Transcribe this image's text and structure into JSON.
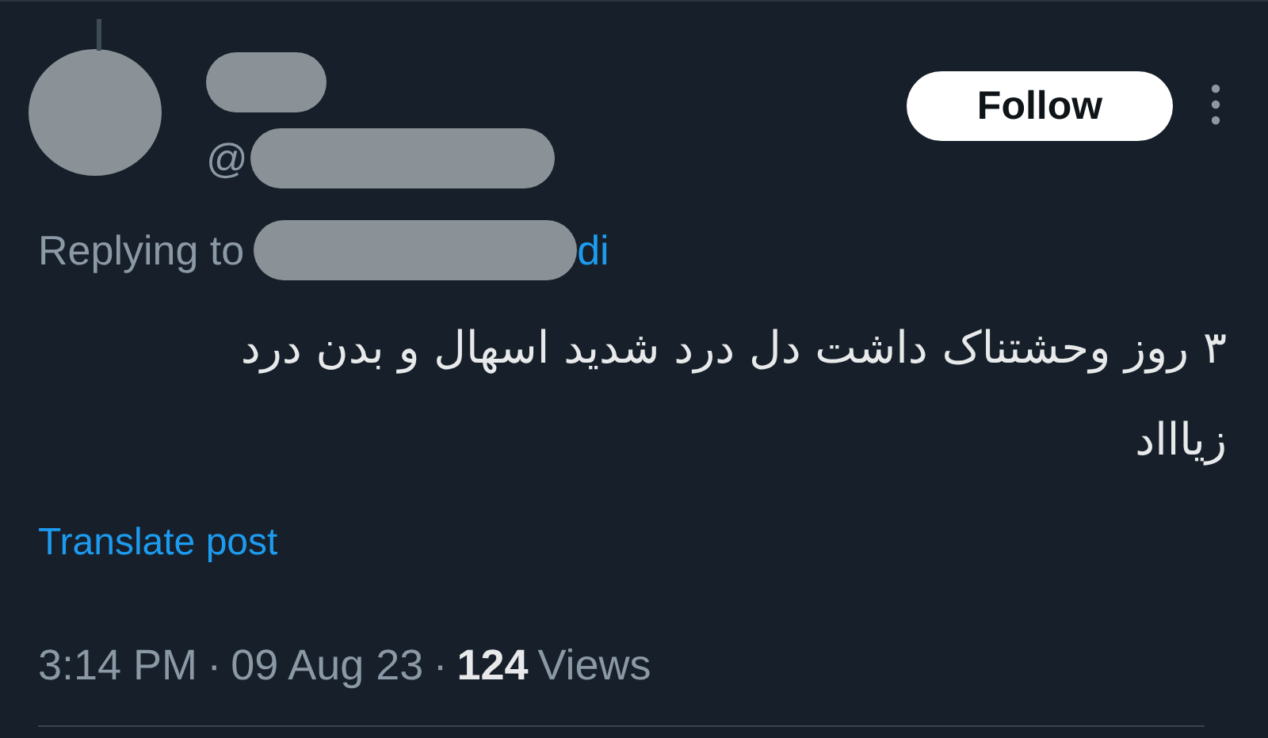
{
  "post": {
    "author": {
      "handle": "@",
      "redacted": true
    },
    "follow_button": "Follow",
    "reply": {
      "label": "Replying to",
      "target": "di"
    },
    "text_lines": [
      "۳ روز وحشتناک داشت دل درد شدید اسهال و بدن درد",
      "زیاااد"
    ],
    "translate_link": "Translate post",
    "meta": {
      "time": "3:14 PM",
      "separator": "·",
      "date": "09 Aug 23",
      "views_count": "124",
      "views_label": "Views"
    }
  }
}
